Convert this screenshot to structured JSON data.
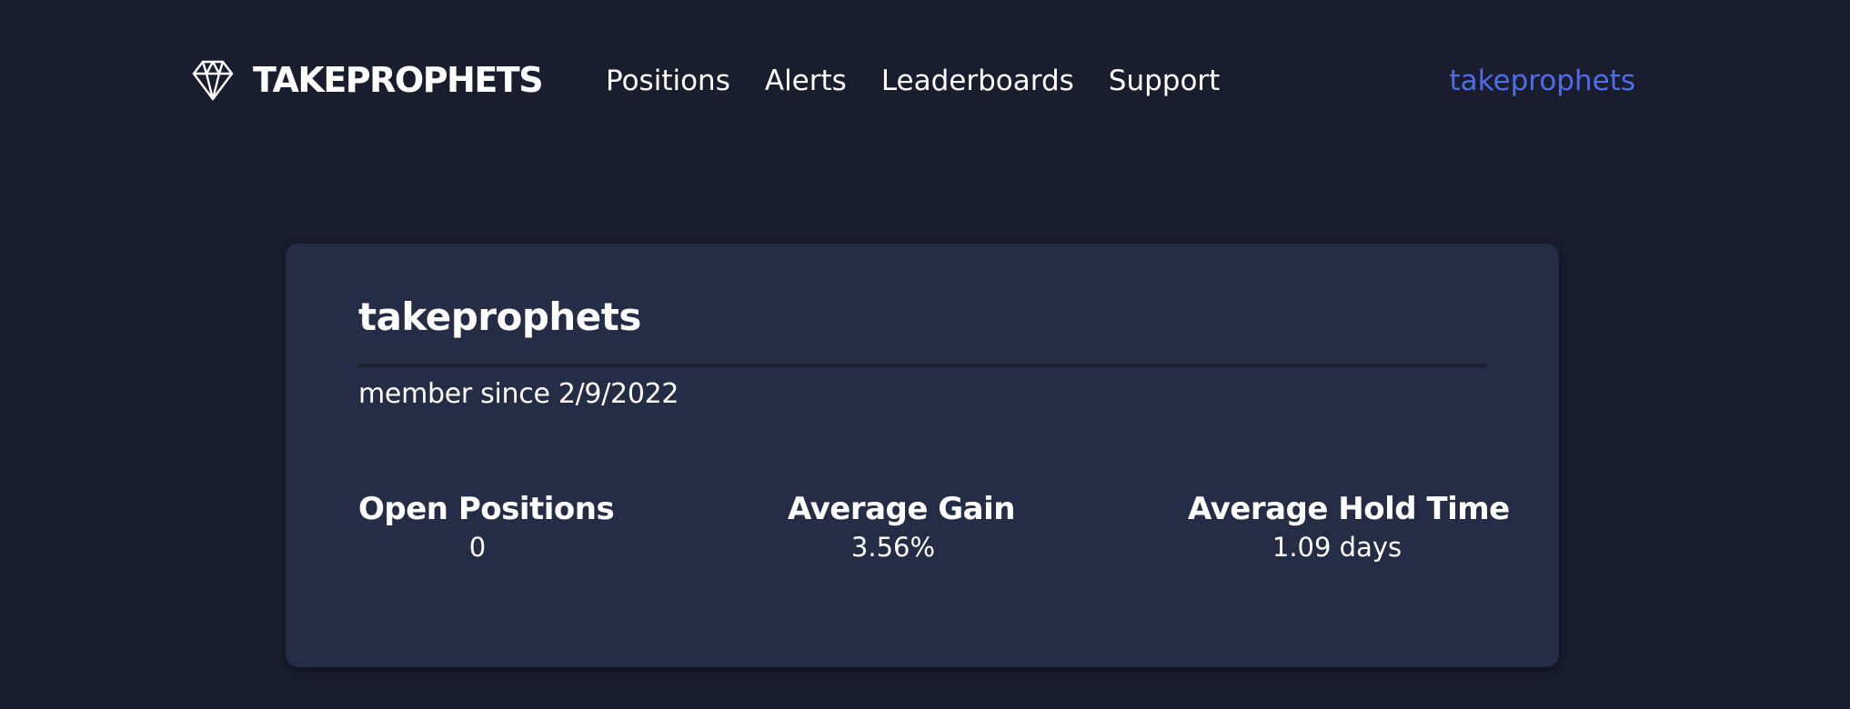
{
  "header": {
    "brand": {
      "icon": "diamond-icon",
      "name": "TAKEPROPHETS"
    },
    "nav": [
      {
        "label": "Positions"
      },
      {
        "label": "Alerts"
      },
      {
        "label": "Leaderboards"
      },
      {
        "label": "Support"
      }
    ],
    "user_link": "takeprophets"
  },
  "profile": {
    "username": "takeprophets",
    "member_since": "member since 2/9/2022",
    "stats": [
      {
        "label": "Open Positions",
        "value": "0"
      },
      {
        "label": "Average Gain",
        "value": "3.56%"
      },
      {
        "label": "Average Hold Time",
        "value": "1.09 days"
      }
    ]
  },
  "colors": {
    "page_background": "#1a1d2e",
    "card_background": "#252c46",
    "accent": "#4f6de6",
    "text": "#ffffff"
  }
}
